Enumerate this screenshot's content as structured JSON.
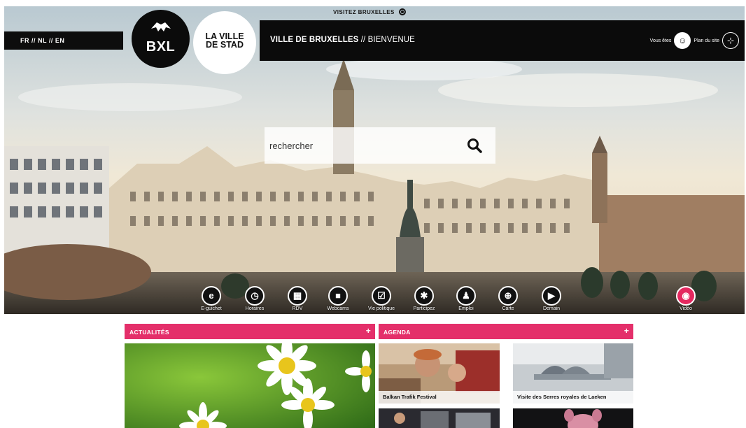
{
  "header": {
    "visitez": "VISITEZ BRUXELLES",
    "languages": [
      "FR",
      "NL",
      "EN"
    ],
    "lang_separator": " // ",
    "logo_bxl": "BXL",
    "logo_ville_line1": "LA VILLE",
    "logo_ville_line2": "DE STAD",
    "title_bold": "VILLE DE BRUXELLES",
    "title_rest": " // BIENVENUE",
    "vous_etes": "Vous êtes",
    "plan_du_site": "Plan du site"
  },
  "search": {
    "placeholder": "rechercher"
  },
  "quicklinks": [
    {
      "label": "E-guichet",
      "icon": "e-icon"
    },
    {
      "label": "Horaires",
      "icon": "clock-icon"
    },
    {
      "label": "RDV",
      "icon": "calendar-icon"
    },
    {
      "label": "Webcams",
      "icon": "camera-icon"
    },
    {
      "label": "Vie politique",
      "icon": "checkbox-icon"
    },
    {
      "label": "Participez",
      "icon": "participate-icon"
    },
    {
      "label": "Emploi",
      "icon": "job-icon"
    },
    {
      "label": "Carte",
      "icon": "globe-icon"
    },
    {
      "label": "Demain",
      "icon": "play-next-icon"
    },
    {
      "label": "Vidéo",
      "icon": "eye-icon"
    }
  ],
  "sections": {
    "actualites": "ACTUALITÉS",
    "agenda": "AGENDA",
    "plus": "+"
  },
  "agenda": [
    {
      "title": "Balkan Trafik Festival"
    },
    {
      "title": "Visite des Serres royales de Laeken"
    }
  ],
  "colors": {
    "accent": "#e42f6a",
    "dark": "#0b0b0b"
  }
}
